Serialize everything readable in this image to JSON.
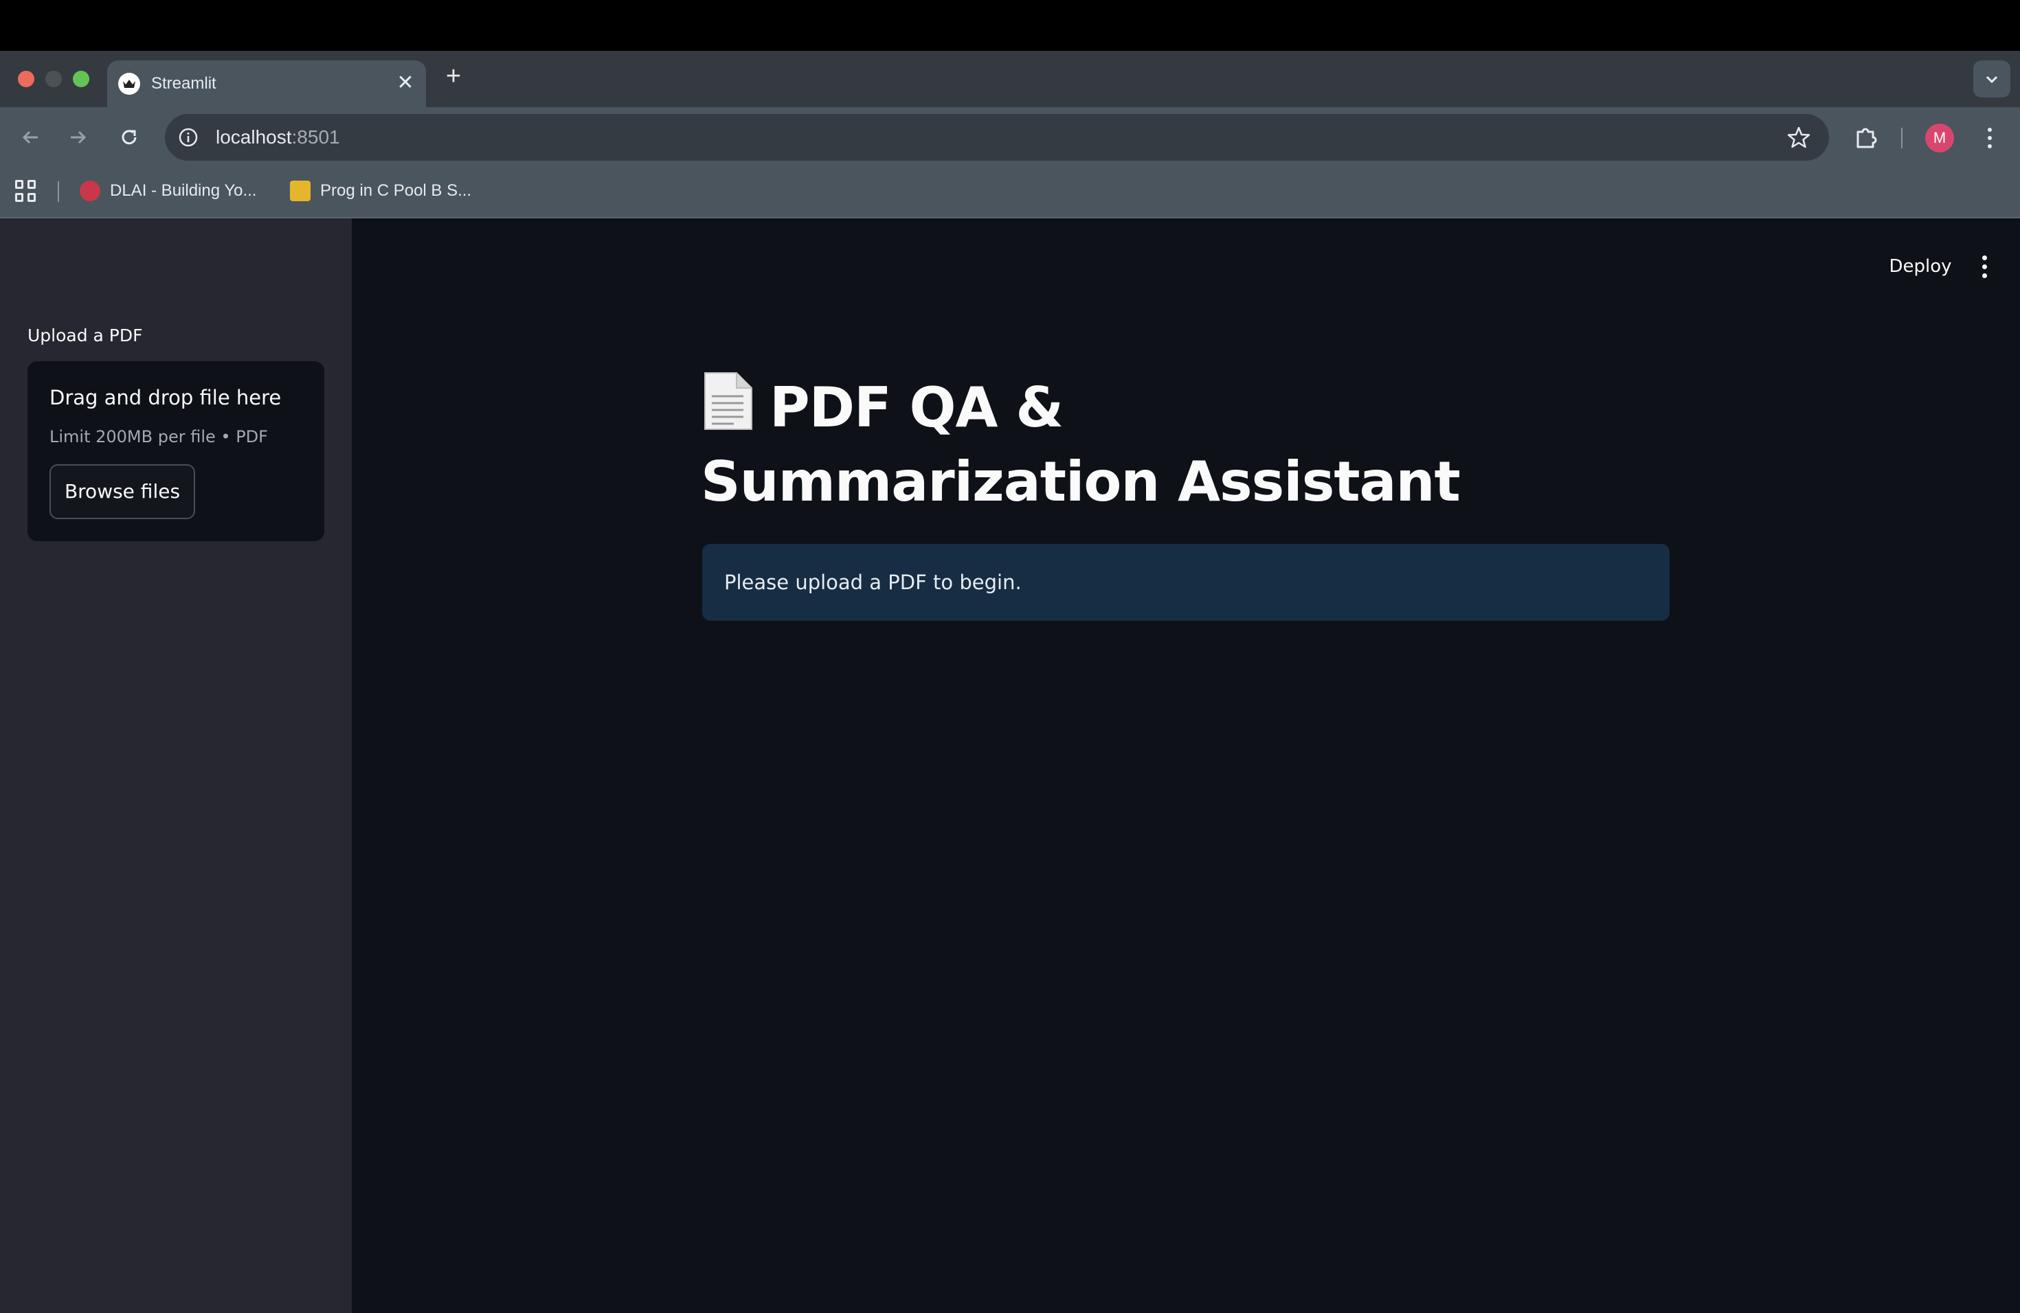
{
  "browser": {
    "tab": {
      "title": "Streamlit",
      "close_glyph": "✕"
    },
    "new_tab_glyph": "+",
    "url": {
      "host": "localhost",
      "port": ":8501"
    },
    "profile_initial": "M",
    "bookmarks": [
      {
        "label": "DLAI - Building Yo...",
        "icon": "dlai-favicon"
      },
      {
        "label": "Prog in C Pool B S...",
        "icon": "classroom-favicon"
      }
    ],
    "colors": {
      "tabstrip": "#343a40",
      "toolbar": "#4a555e",
      "avatar": "#d9466d"
    }
  },
  "app": {
    "sidebar": {
      "upload_label": "Upload a PDF",
      "dropzone_title": "Drag and drop file here",
      "dropzone_limit": "Limit 200MB per file • PDF",
      "browse_button": "Browse files"
    },
    "header": {
      "deploy_label": "Deploy"
    },
    "main": {
      "title_icon": "page-facing-up-icon",
      "title": "PDF QA & Summarization Assistant",
      "info_message": "Please upload a PDF to begin."
    },
    "colors": {
      "sidebar": "#262730",
      "main": "#0e1117",
      "info_box": "#172d43"
    }
  }
}
